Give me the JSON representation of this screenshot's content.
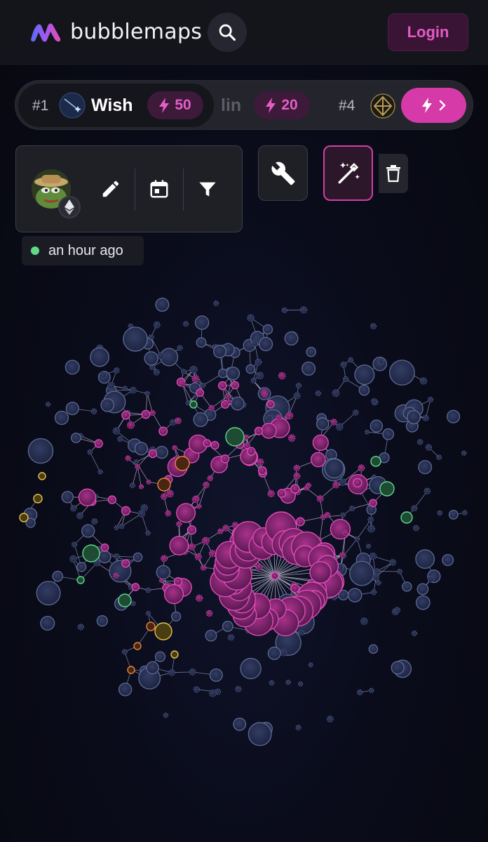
{
  "header": {
    "brand": "bubblemaps",
    "login_label": "Login",
    "icons": [
      "bubblemaps-logo",
      "search-icon"
    ]
  },
  "ticker": {
    "items": [
      {
        "rank": "#1",
        "name": "Wish",
        "boost": "50"
      },
      {
        "rank": "",
        "name": "lin",
        "boost": "20"
      },
      {
        "rank": "#4",
        "name": "",
        "boost": ""
      }
    ],
    "cta_icons": [
      "lightning-icon",
      "chevron-right-icon"
    ]
  },
  "toolbar": {
    "icons": [
      "avatar",
      "ethereum-icon",
      "pencil-icon",
      "calendar-icon",
      "filter-icon",
      "wrench-icon",
      "magic-wand-icon",
      "trash-icon"
    ]
  },
  "status": {
    "timestamp": "an hour ago",
    "live_color": "#5fd98a"
  },
  "colors": {
    "accent": "#d63aa8",
    "cluster": "#c13aa0",
    "node": "#2a3356",
    "node_green": "#3fa364",
    "node_yellow": "#c9a336",
    "node_orange": "#c9743a"
  }
}
